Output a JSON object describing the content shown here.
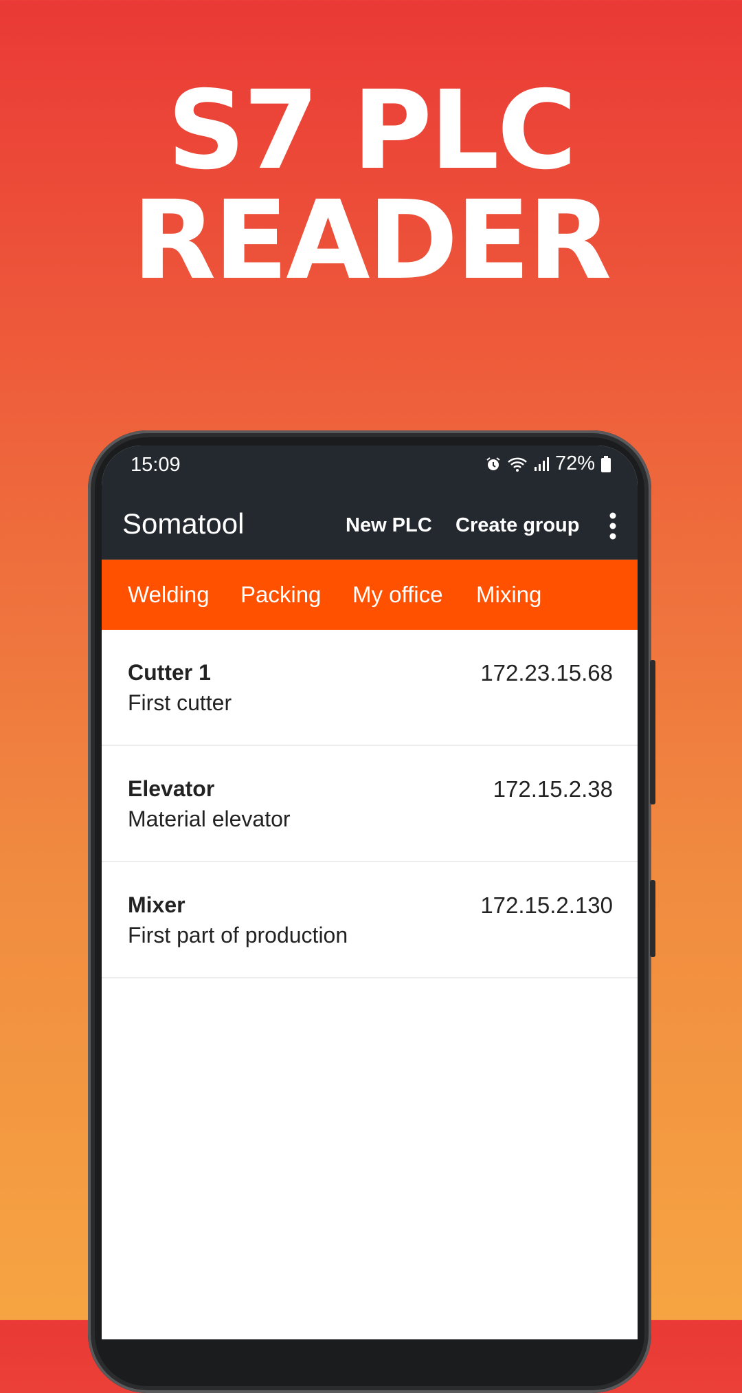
{
  "hero": {
    "line1": "S7 PLC",
    "line2": "READER"
  },
  "status_bar": {
    "time": "15:09",
    "battery": "72%",
    "icons": [
      "alarm-icon",
      "wifi-icon",
      "signal-icon",
      "battery-icon"
    ]
  },
  "app_bar": {
    "title": "Somatool",
    "new_plc": "New PLC",
    "create_group": "Create group"
  },
  "tabs": [
    "Welding",
    "Packing",
    "My office",
    "Mixing"
  ],
  "plcs": [
    {
      "name": "Cutter 1",
      "description": "First cutter",
      "ip": "172.23.15.68"
    },
    {
      "name": "Elevator",
      "description": "Material elevator",
      "ip": "172.15.2.38"
    },
    {
      "name": "Mixer",
      "description": "First part of production",
      "ip": "172.15.2.130"
    }
  ],
  "colors": {
    "accent": "#ff5100",
    "appbar": "#24292f",
    "gradient_top": "#ea3936",
    "gradient_bottom": "#f6a442"
  }
}
